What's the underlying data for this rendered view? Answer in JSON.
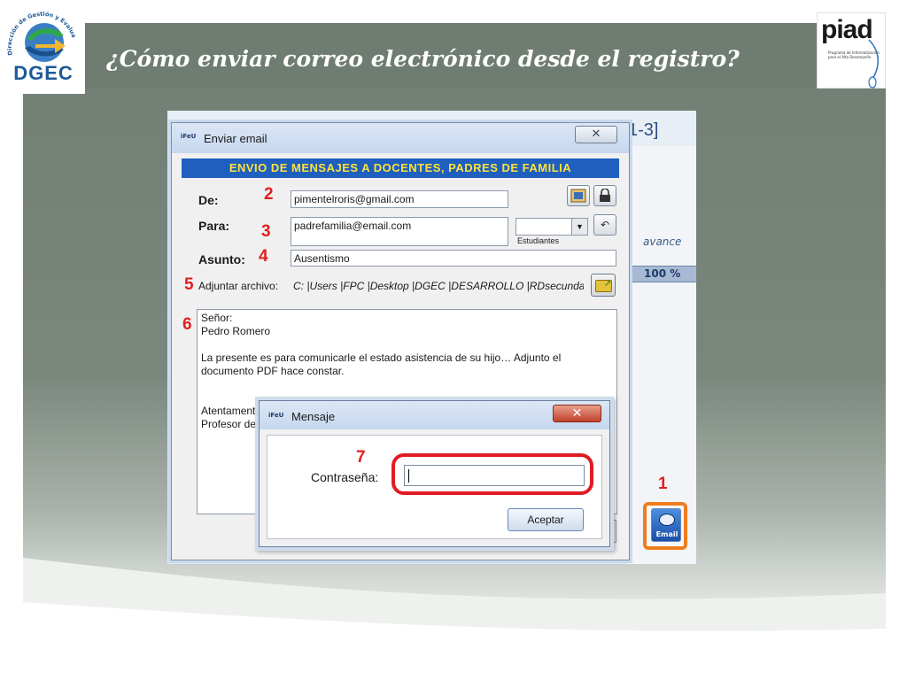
{
  "slide": {
    "title": "¿Cómo enviar correo electrónico desde el registro?",
    "left_logo_text": "DGEC",
    "left_logo_arc_text": "Dirección de Gestión y Evaluación de la Calidad",
    "right_logo_text": "piad",
    "right_logo_subtitle": "Programa de Informatización para el Alto Desempeño"
  },
  "background_window": {
    "period_text": "1-3]",
    "avance_label": "avance",
    "progress_text": "100 %"
  },
  "email_button": {
    "label": "Email",
    "step_number": "1"
  },
  "dialog": {
    "title": "Enviar email",
    "app_icon_text": "iFeU",
    "close_symbol": "✕",
    "header": "ENVIO DE MENSAJES A DOCENTES, PADRES DE FAMILIA",
    "from": {
      "label": "De:",
      "value": "pimentelroris@gmail.com",
      "step_number": "2"
    },
    "to": {
      "label": "Para:",
      "value": "padrefamilia@email.com",
      "step_number": "3",
      "students_label": "Estudiantes",
      "students_value": ""
    },
    "subject": {
      "label": "Asunto:",
      "value": "Ausentismo",
      "step_number": "4"
    },
    "attachment": {
      "label": "Adjuntar archivo:",
      "path": "C: |Users |FPC |Desktop |DGEC |DESARROLLO |RDsecundaria",
      "step_number": "5"
    },
    "message": {
      "step_number": "6",
      "lines": [
        "Señor:",
        "Pedro Romero",
        "",
        "La presente es para comunicarle el estado asistencia de su hijo… Adjunto el",
        "documento PDF hace constar.",
        "",
        "",
        "Atentamente",
        "Profesor de"
      ]
    }
  },
  "popup": {
    "title": "Mensaje",
    "app_icon_text": "iFeU",
    "close_symbol": "✕",
    "password_label": "Contraseña:",
    "password_value": "",
    "step_number": "7",
    "accept_label": "Aceptar"
  },
  "colors": {
    "slide_bg": "#707d73",
    "dialog_header_bg": "#1f5fbf",
    "dialog_header_text": "#ffe23a",
    "step_number": "#e02020",
    "orange_highlight": "#f07d1e",
    "red_highlight": "#e01b24"
  },
  "icons": {
    "contacts_button": "contacts-icon",
    "lock_button": "lock-icon",
    "undo_button": "undo-icon",
    "attach_button": "folder-open-icon",
    "email_button": "email-icon"
  }
}
